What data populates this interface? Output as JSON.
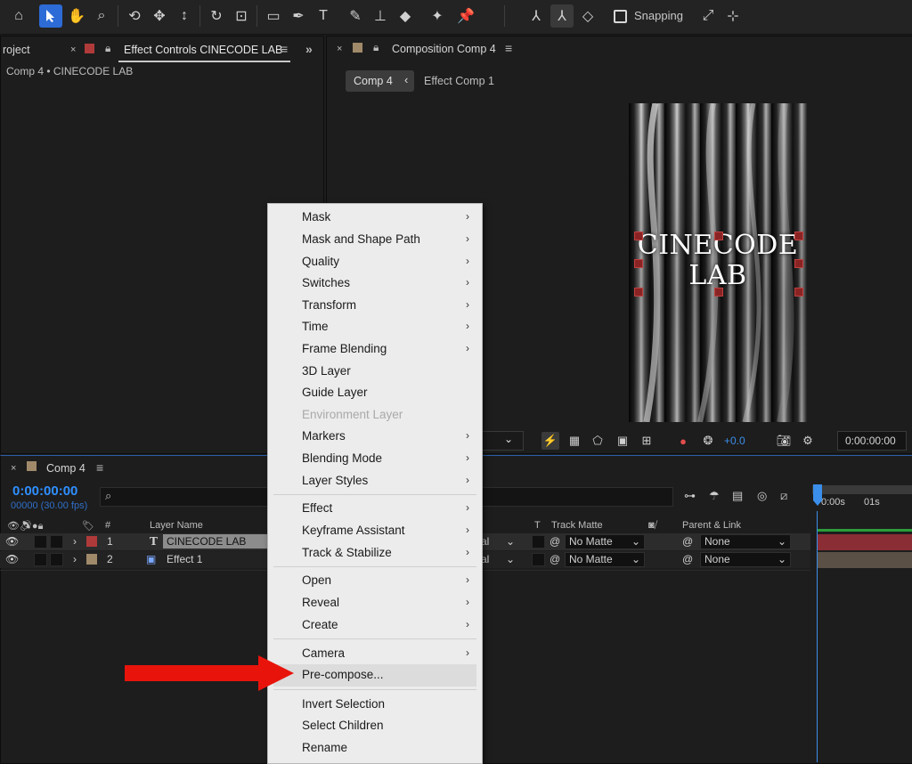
{
  "toolbar": {
    "tools": [
      "home-icon",
      "selection-tool-icon",
      "hand-tool-icon",
      "zoom-tool-icon",
      "orbit-tool-icon",
      "pan-tool-icon",
      "dolly-tool-icon",
      "rotation-tool-icon",
      "anchor-tool-icon",
      "rectangle-tool-icon",
      "pen-tool-icon",
      "type-tool-icon",
      "brush-tool-icon",
      "clone-stamp-icon",
      "eraser-tool-icon",
      "roto-brush-icon",
      "puppet-pin-icon"
    ],
    "snapping_label": "Snapping"
  },
  "project_panel": {
    "project_tab": "roject",
    "effect_controls_tab": "Effect Controls CINECODE LAB",
    "subtitle": "Comp 4 • CINECODE LAB"
  },
  "composition_panel": {
    "tab": "Composition Comp 4",
    "breadcrumb_active": "Comp 4",
    "breadcrumb_next": "Effect Comp 1",
    "comp_text_line1": "CINECODE",
    "comp_text_line2": "LAB",
    "exposure": "+0.0",
    "timecode": "0:00:00:00"
  },
  "timeline": {
    "tab": "Comp 4",
    "timecode": "0:00:00:00",
    "frames": "00000 (30.00 fps)",
    "search_placeholder": "",
    "columns": {
      "number": "#",
      "layer_name": "Layer Name",
      "t": "T",
      "track_matte": "Track Matte",
      "parent_link": "Parent & Link"
    },
    "ruler": {
      "t0": "0:00s",
      "t1": "01s"
    },
    "layers": [
      {
        "index": "1",
        "name": "CINECODE LAB",
        "mode": "al",
        "matte": "No Matte",
        "parent": "None",
        "label_color": "#b03a3a"
      },
      {
        "index": "2",
        "name": "Effect 1",
        "mode": "al",
        "matte": "No Matte",
        "parent": "None",
        "label_color": "#a08a6a"
      }
    ]
  },
  "context_menu": {
    "items": [
      {
        "label": "Mask",
        "submenu": true
      },
      {
        "label": "Mask and Shape Path",
        "submenu": true
      },
      {
        "label": "Quality",
        "submenu": true
      },
      {
        "label": "Switches",
        "submenu": true
      },
      {
        "label": "Transform",
        "submenu": true
      },
      {
        "label": "Time",
        "submenu": true
      },
      {
        "label": "Frame Blending",
        "submenu": true
      },
      {
        "label": "3D Layer",
        "submenu": false
      },
      {
        "label": "Guide Layer",
        "submenu": false
      },
      {
        "label": "Environment Layer",
        "submenu": false,
        "disabled": true
      },
      {
        "label": "Markers",
        "submenu": true
      },
      {
        "label": "Blending Mode",
        "submenu": true
      },
      {
        "label": "Layer Styles",
        "submenu": true
      },
      {
        "label": "Effect",
        "submenu": true
      },
      {
        "label": "Keyframe Assistant",
        "submenu": true
      },
      {
        "label": "Track & Stabilize",
        "submenu": true
      },
      {
        "label": "Open",
        "submenu": true
      },
      {
        "label": "Reveal",
        "submenu": true
      },
      {
        "label": "Create",
        "submenu": true
      },
      {
        "label": "Camera",
        "submenu": true
      },
      {
        "label": "Pre-compose...",
        "submenu": false,
        "highlighted": true
      },
      {
        "label": "Invert Selection",
        "submenu": false
      },
      {
        "label": "Select Children",
        "submenu": false
      },
      {
        "label": "Rename",
        "submenu": false
      }
    ]
  },
  "colors": {
    "accent": "#2d6bd6",
    "timecode": "#2f8fff",
    "arrow": "#e8140c",
    "layer1_label": "#b03a3a",
    "layer2_label": "#a08a6a"
  }
}
